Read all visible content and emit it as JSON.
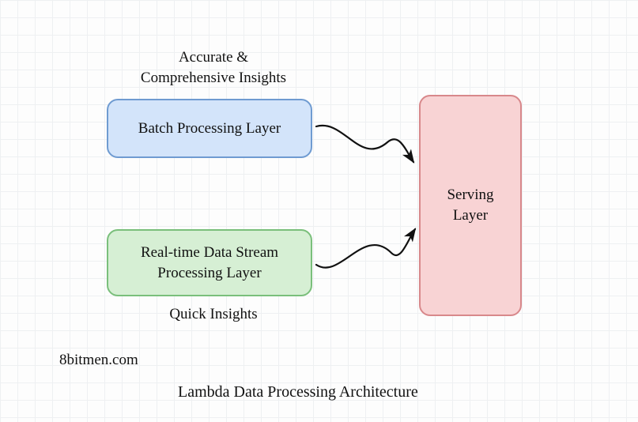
{
  "diagram": {
    "title": "Lambda Data Processing Architecture",
    "watermark": "8bitmen.com",
    "boxes": {
      "batch": {
        "label": "Batch Processing Layer",
        "annotation": "Accurate &\nComprehensive Insights"
      },
      "stream": {
        "label": "Real-time Data Stream\nProcessing Layer",
        "annotation": "Quick Insights"
      },
      "serving": {
        "label": "Serving\nLayer"
      }
    }
  }
}
